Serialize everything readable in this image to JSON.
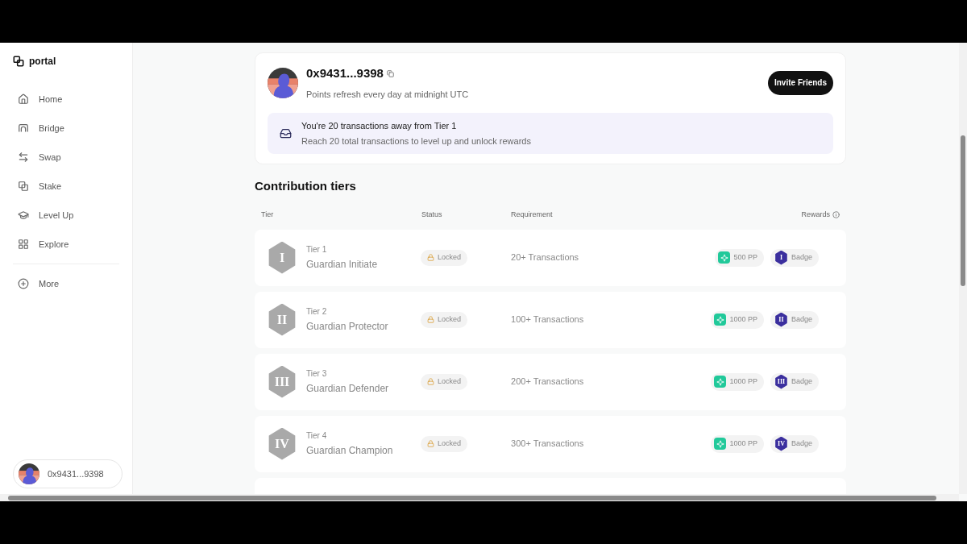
{
  "sidebar": {
    "logo": "portal",
    "items": [
      {
        "label": "Home"
      },
      {
        "label": "Bridge"
      },
      {
        "label": "Swap"
      },
      {
        "label": "Stake"
      },
      {
        "label": "Level Up"
      },
      {
        "label": "Explore"
      }
    ],
    "more": "More",
    "account": "0x9431...9398"
  },
  "profile": {
    "address": "0x9431...9398",
    "subtitle": "Points refresh every day at midnight UTC",
    "invite_button": "Invite Friends",
    "notice_title": "You're 20 transactions away from Tier 1",
    "notice_text": "Reach 20 total transactions to level up and unlock rewards"
  },
  "tiers": {
    "title": "Contribution tiers",
    "columns": [
      "Tier",
      "Status",
      "Requirement",
      "Rewards"
    ],
    "rows": [
      {
        "numeral": "I",
        "tier": "Tier 1",
        "name": "Guardian Initiate",
        "status": "Locked",
        "requirement": "20+ Transactions",
        "points": "500 PP",
        "badge_numeral": "I",
        "badge": "Badge"
      },
      {
        "numeral": "II",
        "tier": "Tier 2",
        "name": "Guardian Protector",
        "status": "Locked",
        "requirement": "100+ Transactions",
        "points": "1000 PP",
        "badge_numeral": "II",
        "badge": "Badge"
      },
      {
        "numeral": "III",
        "tier": "Tier 3",
        "name": "Guardian Defender",
        "status": "Locked",
        "requirement": "200+ Transactions",
        "points": "1000 PP",
        "badge_numeral": "III",
        "badge": "Badge"
      },
      {
        "numeral": "IV",
        "tier": "Tier 4",
        "name": "Guardian Champion",
        "status": "Locked",
        "requirement": "300+ Transactions",
        "points": "1000 PP",
        "badge_numeral": "IV",
        "badge": "Badge"
      }
    ]
  }
}
